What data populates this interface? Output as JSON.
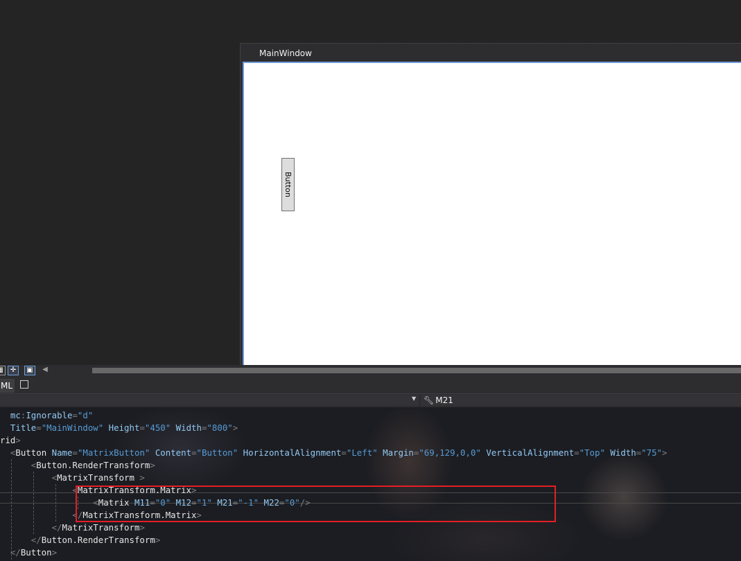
{
  "designer": {
    "window_title": "MainWindow",
    "button_label": "Button"
  },
  "tabs": {
    "active_label": "ML"
  },
  "navbar": {
    "right_selector": "M21"
  },
  "code_lines": [
    [
      {
        "c": "attr",
        "t": "  mc"
      },
      {
        "c": "tag",
        "t": ":"
      },
      {
        "c": "attr",
        "t": "Ignorable"
      },
      {
        "c": "tag",
        "t": "="
      },
      {
        "c": "str",
        "t": "\"d\""
      }
    ],
    [
      {
        "c": "attr",
        "t": "  Title"
      },
      {
        "c": "tag",
        "t": "="
      },
      {
        "c": "str",
        "t": "\"MainWindow\""
      },
      {
        "c": "attr",
        "t": " Height"
      },
      {
        "c": "tag",
        "t": "="
      },
      {
        "c": "str",
        "t": "\"450\""
      },
      {
        "c": "attr",
        "t": " Width"
      },
      {
        "c": "tag",
        "t": "="
      },
      {
        "c": "str",
        "t": "\"800\""
      },
      {
        "c": "tag",
        "t": ">"
      }
    ],
    [
      {
        "c": "name",
        "t": "rid"
      },
      {
        "c": "tag",
        "t": ">"
      }
    ],
    [
      {
        "c": "tag",
        "t": "  <"
      },
      {
        "c": "name",
        "t": "Button"
      },
      {
        "c": "attr",
        "t": " Name"
      },
      {
        "c": "tag",
        "t": "="
      },
      {
        "c": "str",
        "t": "\"MatrixButton\""
      },
      {
        "c": "attr",
        "t": " Content"
      },
      {
        "c": "tag",
        "t": "="
      },
      {
        "c": "str",
        "t": "\"Button\""
      },
      {
        "c": "attr",
        "t": " HorizontalAlignment"
      },
      {
        "c": "tag",
        "t": "="
      },
      {
        "c": "str",
        "t": "\"Left\""
      },
      {
        "c": "attr",
        "t": " Margin"
      },
      {
        "c": "tag",
        "t": "="
      },
      {
        "c": "str",
        "t": "\"69,129,0,0\""
      },
      {
        "c": "attr",
        "t": " VerticalAlignment"
      },
      {
        "c": "tag",
        "t": "="
      },
      {
        "c": "str",
        "t": "\"Top\""
      },
      {
        "c": "attr",
        "t": " Width"
      },
      {
        "c": "tag",
        "t": "="
      },
      {
        "c": "str",
        "t": "\"75\""
      },
      {
        "c": "tag",
        "t": ">"
      }
    ],
    [
      {
        "c": "tag",
        "t": "      <"
      },
      {
        "c": "name",
        "t": "Button.RenderTransform"
      },
      {
        "c": "tag",
        "t": ">"
      }
    ],
    [
      {
        "c": "tag",
        "t": "          <"
      },
      {
        "c": "name",
        "t": "MatrixTransform"
      },
      {
        "c": "tag",
        "t": " >"
      }
    ],
    [
      {
        "c": "tag",
        "t": "              <"
      },
      {
        "c": "name",
        "t": "MatrixTransform.Matrix"
      },
      {
        "c": "tag",
        "t": ">"
      }
    ],
    [
      {
        "c": "tag",
        "t": "                  <"
      },
      {
        "c": "name",
        "t": "Matrix"
      },
      {
        "c": "attr",
        "t": " M11"
      },
      {
        "c": "tag",
        "t": "="
      },
      {
        "c": "str",
        "t": "\"0\""
      },
      {
        "c": "attr",
        "t": " M12"
      },
      {
        "c": "tag",
        "t": "="
      },
      {
        "c": "str",
        "t": "\"1\""
      },
      {
        "c": "attr",
        "t": " M21"
      },
      {
        "c": "tag",
        "t": "="
      },
      {
        "c": "str",
        "t": "\"-1\""
      },
      {
        "c": "attr",
        "t": " M22"
      },
      {
        "c": "tag",
        "t": "="
      },
      {
        "c": "str",
        "t": "\"0\""
      },
      {
        "c": "tag",
        "t": "/>"
      }
    ],
    [
      {
        "c": "tag",
        "t": "              </"
      },
      {
        "c": "name",
        "t": "MatrixTransform.Matrix"
      },
      {
        "c": "tag",
        "t": ">"
      }
    ],
    [
      {
        "c": "tag",
        "t": "          </"
      },
      {
        "c": "name",
        "t": "MatrixTransform"
      },
      {
        "c": "tag",
        "t": ">"
      }
    ],
    [
      {
        "c": "tag",
        "t": "      </"
      },
      {
        "c": "name",
        "t": "Button.RenderTransform"
      },
      {
        "c": "tag",
        "t": ">"
      }
    ],
    [
      {
        "c": "tag",
        "t": "  </"
      },
      {
        "c": "name",
        "t": "Button"
      },
      {
        "c": "tag",
        "t": ">"
      }
    ]
  ],
  "colors": {
    "highlight_box": "#e51e25",
    "attr": "#92caf4",
    "string": "#569cd6"
  }
}
